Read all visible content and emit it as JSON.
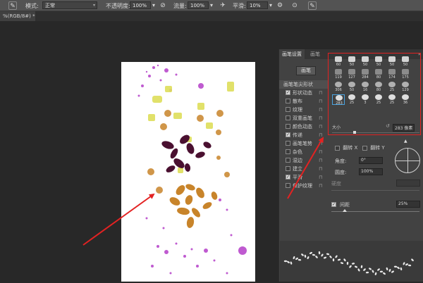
{
  "options_bar": {
    "mode_label": "模式:",
    "mode_value": "正常",
    "opacity_label": "不透明度:",
    "opacity_value": "100%",
    "flow_label": "流量:",
    "flow_value": "100%",
    "smoothing_label": "平滑:",
    "smoothing_value": "10%"
  },
  "document_tab": {
    "title": "%(RGB/8#) *",
    "close_glyph": "×"
  },
  "brush_panel": {
    "tabs": [
      "画笔设置",
      "画笔"
    ],
    "menu_glyph": "»",
    "presets_button": "画笔",
    "sections": [
      {
        "label": "画笔笔尖形状",
        "header": true
      },
      {
        "label": "形状动态",
        "checked": true
      },
      {
        "label": "散布",
        "checked": false
      },
      {
        "label": "纹理",
        "checked": false
      },
      {
        "label": "双重画笔",
        "checked": false
      },
      {
        "label": "颜色动态",
        "checked": false
      },
      {
        "label": "传递",
        "checked": true
      },
      {
        "label": "画笔笔势",
        "checked": false
      },
      {
        "label": "杂色",
        "checked": false
      },
      {
        "label": "湿边",
        "checked": false
      },
      {
        "label": "建立",
        "checked": false
      },
      {
        "label": "平滑",
        "checked": true
      },
      {
        "label": "保护纹理",
        "checked": false
      }
    ],
    "brush_tips": [
      {
        "size": "60"
      },
      {
        "size": "50"
      },
      {
        "size": "50"
      },
      {
        "size": "50"
      },
      {
        "size": "50"
      },
      {
        "size": "50"
      },
      {
        "size": "119"
      },
      {
        "size": "127"
      },
      {
        "size": "284"
      },
      {
        "size": "80"
      },
      {
        "size": "174"
      },
      {
        "size": "175"
      },
      {
        "size": "306"
      },
      {
        "size": "50"
      },
      {
        "size": "16"
      },
      {
        "size": "80"
      },
      {
        "size": "25"
      },
      {
        "size": "129"
      },
      {
        "size": "283"
      },
      {
        "size": "25"
      },
      {
        "size": "3"
      },
      {
        "size": "25"
      },
      {
        "size": "25"
      },
      {
        "size": "36"
      }
    ],
    "size_label": "大小",
    "size_value": "283 像素",
    "flip_x_label": "翻转 X",
    "flip_y_label": "翻转 Y",
    "angle_label": "角度:",
    "angle_value": "0°",
    "roundness_label": "圆度:",
    "roundness_value": "100%",
    "hardness_label": "硬度",
    "spacing_label": "间距",
    "spacing_value": "25%"
  },
  "colors": {
    "annotation_red": "#e32222",
    "leaf_dark": "#4a1030",
    "leaf_orange": "#c8842a",
    "splatter_purple": "#b43ec8",
    "splatter_yellow": "#dede5a"
  }
}
